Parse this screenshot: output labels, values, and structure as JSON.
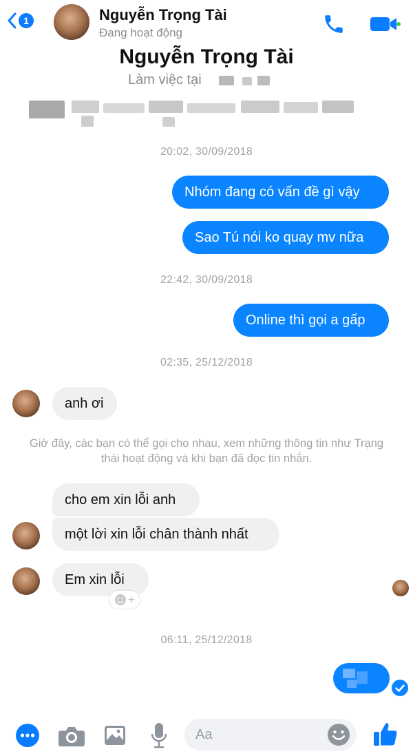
{
  "header": {
    "back_badge": "1",
    "contact_name": "Nguyễn Trọng Tài",
    "status": "Đang hoạt động",
    "call_icon": "phone-icon",
    "video_icon": "video-camera-icon"
  },
  "profile": {
    "name": "Nguyễn Trọng Tài",
    "work": "Làm việc tại"
  },
  "conversation": {
    "stamp_1": "20:02, 30/09/2018",
    "out_1": "Nhóm đang có vấn đề gì vậy",
    "out_2": "Sao Tú nói ko quay mv nữa",
    "stamp_2": "22:42, 30/09/2018",
    "out_3": "Online thì gọi a gấp",
    "stamp_3": "02:35, 25/12/2018",
    "in_1": "anh ơi",
    "system_note": "Giờ đây, các bạn có thể gọi cho nhau, xem những thông tin như Trạng thái hoạt động và khi bạn đã đọc tin nhắn.",
    "in_2": "cho em xin lỗi anh",
    "in_3": "một lời xin lỗi chân thành nhất",
    "in_4": "Em xin lỗi",
    "stamp_4": "06:11, 25/12/2018"
  },
  "composer": {
    "placeholder": "Aa",
    "icons": [
      "more-icon",
      "camera-icon",
      "gallery-icon",
      "microphone-icon",
      "emoji-icon",
      "thumbs-up-icon"
    ]
  },
  "colors": {
    "accent": "#0a84ff",
    "incoming_bubble": "#f0f0f0",
    "meta_text": "#a0a3a7"
  }
}
